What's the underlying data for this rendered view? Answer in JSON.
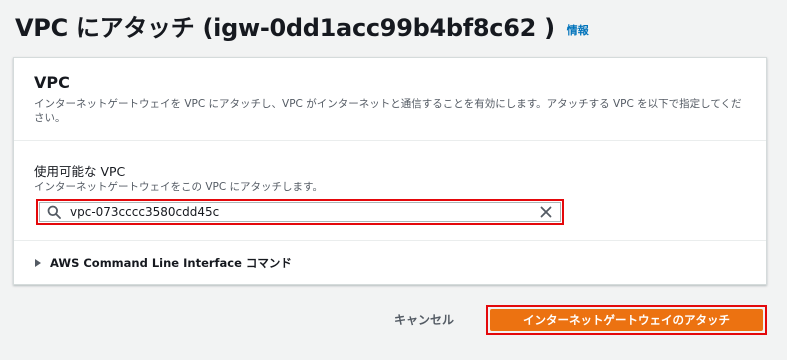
{
  "header": {
    "title": "VPC にアタッチ (igw-0dd1acc99b4bf8c62 )",
    "info_link": "情報"
  },
  "vpc_section": {
    "title": "VPC",
    "description": "インターネットゲートウェイを VPC にアタッチし、VPC がインターネットと通信することを有効にします。アタッチする VPC を以下で指定してください。"
  },
  "available_vpc": {
    "label": "使用可能な VPC",
    "description": "インターネットゲートウェイをこの VPC にアタッチします。",
    "value": "vpc-073cccc3580cdd45c",
    "icons": {
      "search": "search-icon",
      "clear": "close-icon"
    }
  },
  "cli": {
    "label": "AWS Command Line Interface コマンド",
    "icon": "caret-right-icon"
  },
  "actions": {
    "cancel_label": "キャンセル",
    "attach_label": "インターネットゲートウェイのアタッチ"
  },
  "colors": {
    "primary": "#ec7211",
    "highlight": "#e4080b",
    "link": "#0073bb",
    "background": "#f2f3f3"
  }
}
